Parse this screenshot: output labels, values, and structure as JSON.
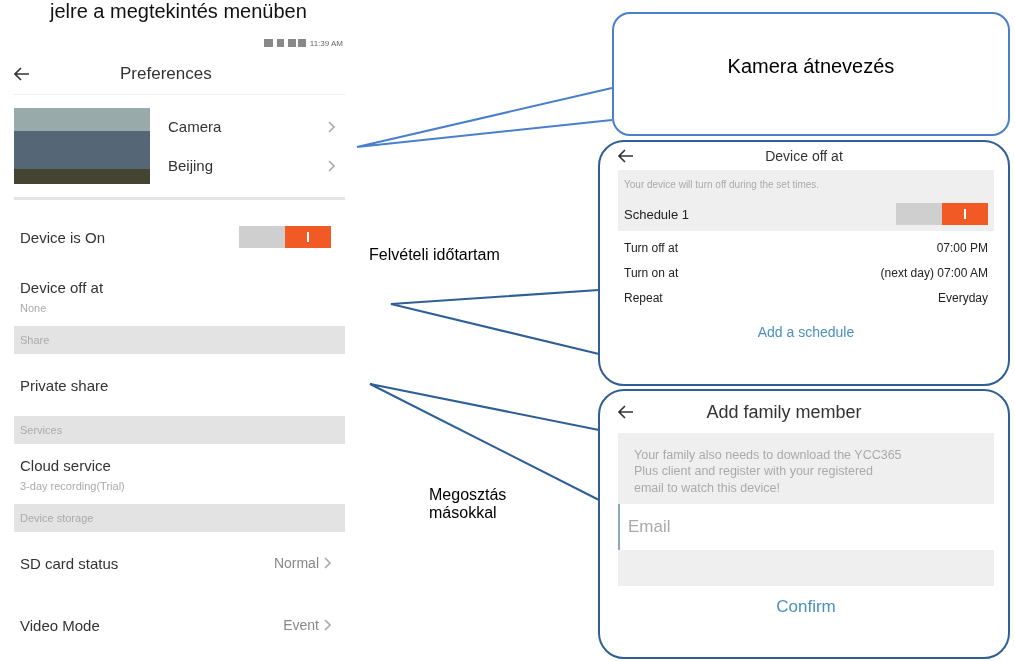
{
  "heading_fragment": "jelre a megtekintés menüben",
  "preferences_screen": {
    "status_time": "11:39 AM",
    "title": "Preferences",
    "camera": {
      "name": "Camera",
      "location": "Beijing"
    },
    "items": [
      {
        "kind": "toggle",
        "label": "Device is On",
        "on": true
      },
      {
        "kind": "detail",
        "label": "Device off at",
        "subtitle": "None"
      },
      {
        "kind": "section",
        "label": "Share"
      },
      {
        "kind": "link",
        "label": "Private share"
      },
      {
        "kind": "section",
        "label": "Services"
      },
      {
        "kind": "detail",
        "label": "Cloud service",
        "subtitle": "3-day recording(Trial)"
      },
      {
        "kind": "section",
        "label": "Device storage"
      },
      {
        "kind": "value",
        "label": "SD card status",
        "value": "Normal"
      },
      {
        "kind": "value",
        "label": "Video Mode",
        "value": "Event"
      }
    ]
  },
  "callouts": [
    {
      "text": "Kamera átnevezés"
    },
    {
      "text": "Felvételi időtartam"
    },
    {
      "text": "Megosztás másokkal"
    }
  ],
  "schedule_screen": {
    "title": "Device off at",
    "notice": "Your device will turn off during the set times.",
    "schedules": [
      {
        "name": "Schedule 1",
        "on": true,
        "rows": [
          {
            "label": "Turn off at",
            "value": "07:00 PM"
          },
          {
            "label": "Turn on at",
            "value": "(next day) 07:00 AM"
          },
          {
            "label": "Repeat",
            "value": "Everyday"
          }
        ]
      }
    ],
    "add_button": "Add a schedule"
  },
  "family_screen": {
    "title": "Add family member",
    "notice": "Your family also needs to download the YCC365 Plus client and register with your registered email to watch this device!",
    "email_placeholder": "Email",
    "confirm_button": "Confirm"
  }
}
